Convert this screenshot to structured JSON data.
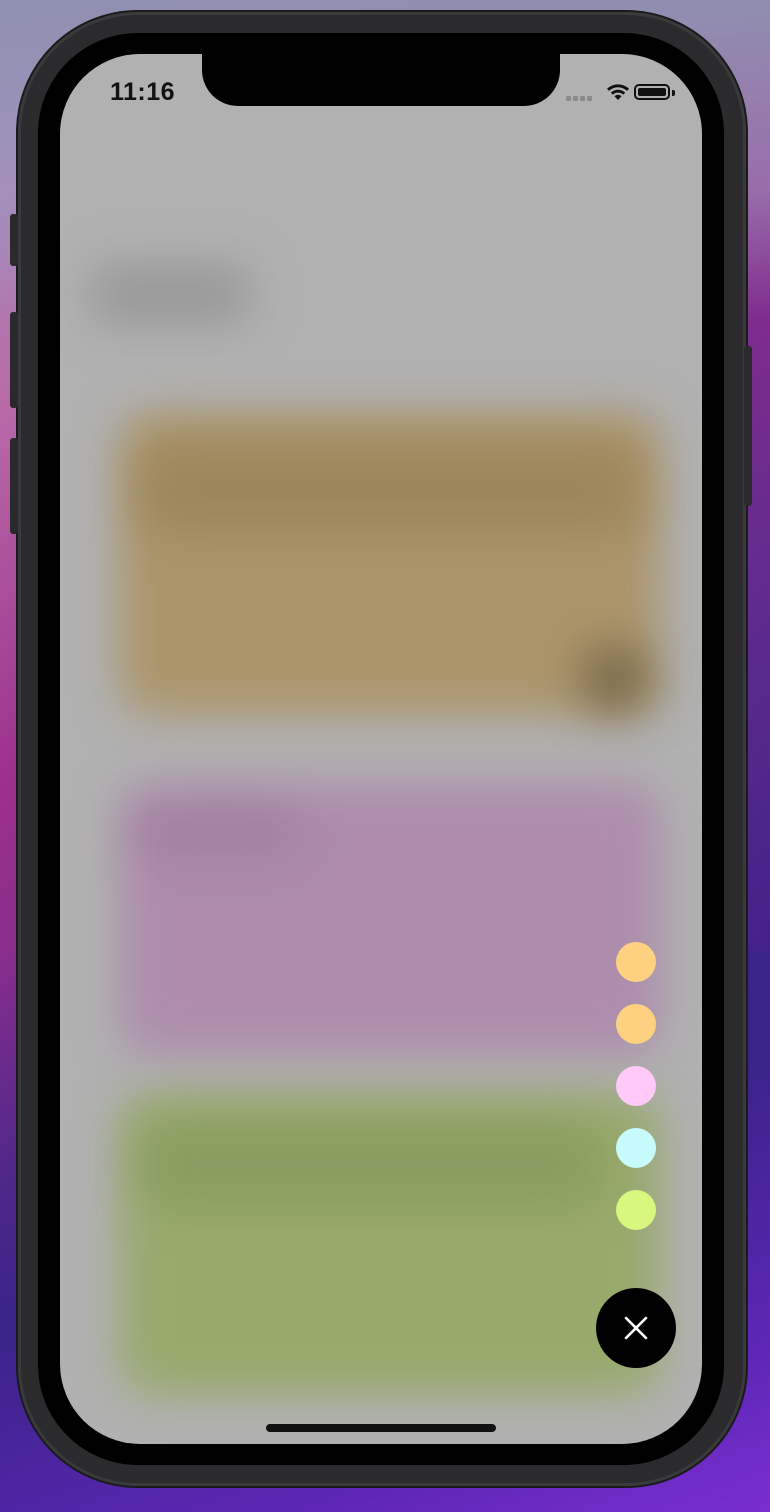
{
  "status_bar": {
    "time": "11:16"
  },
  "color_palette": {
    "colors": [
      {
        "name": "orange",
        "hex": "#fdd180"
      },
      {
        "name": "orange",
        "hex": "#fdd180"
      },
      {
        "name": "pink",
        "hex": "#ffc9f8"
      },
      {
        "name": "cyan",
        "hex": "#c8fbfb"
      },
      {
        "name": "lime",
        "hex": "#d7f77f"
      }
    ]
  },
  "fab": {
    "icon": "close-icon"
  },
  "background_notes": {
    "colors": [
      "#a68b5f",
      "#ab8aa9",
      "#94a66a"
    ]
  }
}
